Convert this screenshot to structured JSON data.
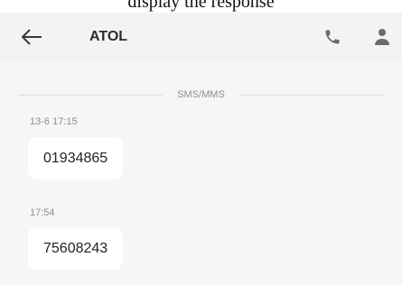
{
  "banner": {
    "text": "display the response"
  },
  "header": {
    "title": "ATOL",
    "icons": {
      "back": "arrow-left-icon",
      "call": "phone-icon",
      "contact": "person-icon"
    }
  },
  "conversation": {
    "channel_label": "SMS/MMS",
    "messages": [
      {
        "timestamp": "13-6 17:15",
        "text": "01934865"
      },
      {
        "timestamp": "17:54",
        "text": "75608243"
      }
    ]
  },
  "colors": {
    "header_bg": "#f3f3f3",
    "content_bg": "#f6f6f6",
    "bubble_bg": "#ffffff",
    "icon": "#6b6b6b",
    "secondary_text": "#8d8d8d"
  }
}
